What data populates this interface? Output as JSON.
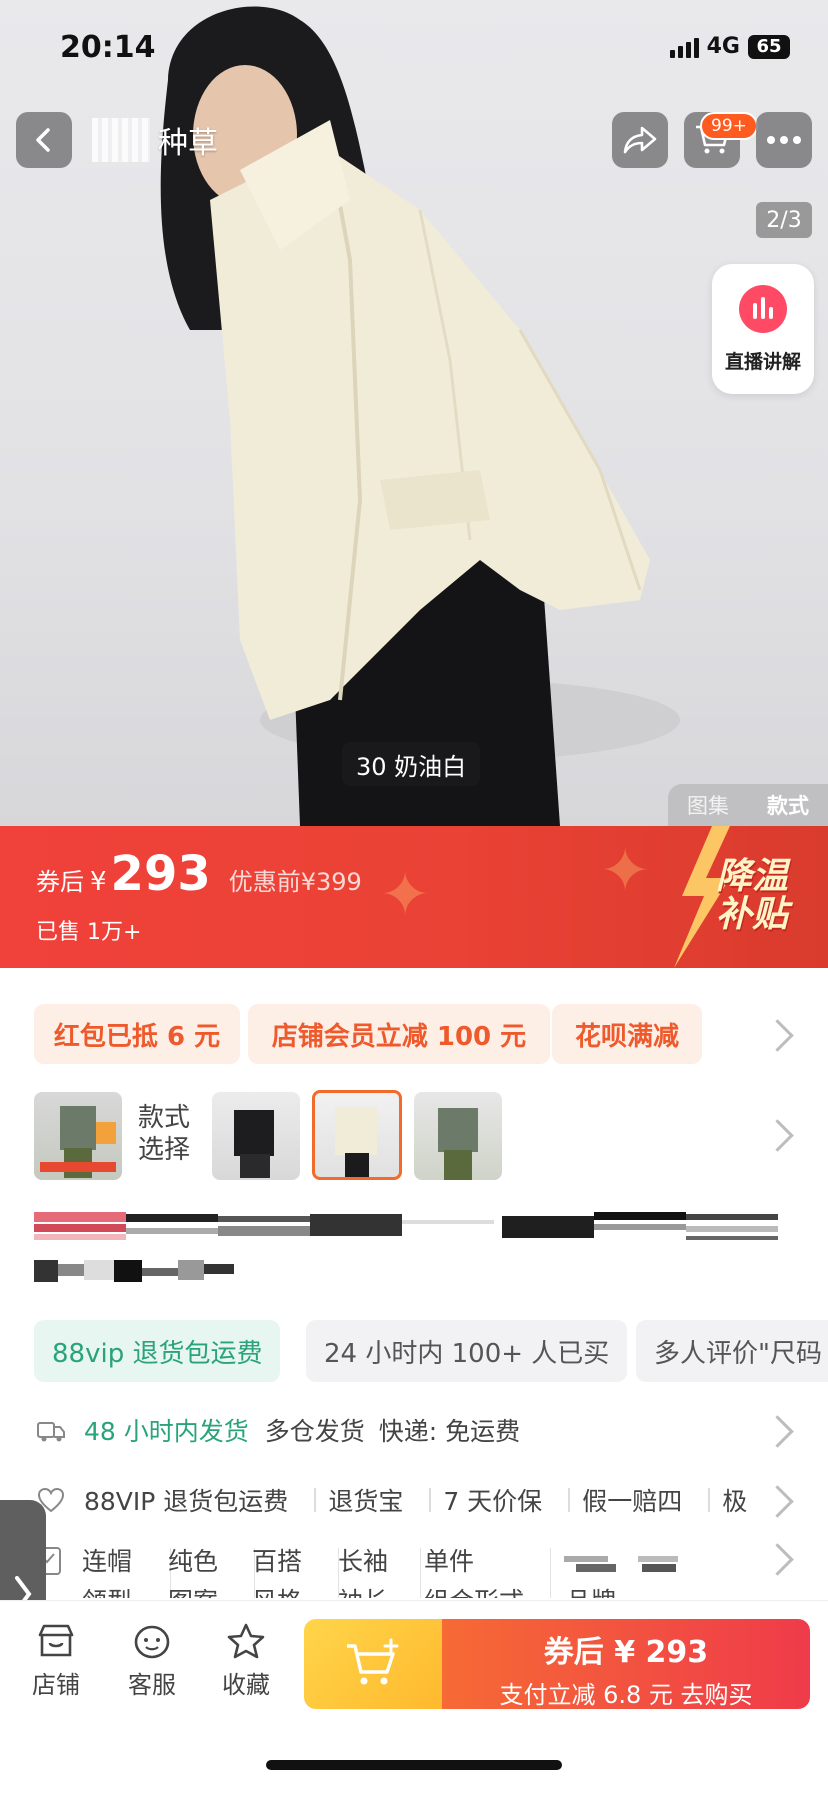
{
  "status_bar": {
    "time": "20:14",
    "network": "4G",
    "battery": "65"
  },
  "header": {
    "brand_text": "种草",
    "cart_badge": "99+",
    "gallery_counter": "2/3"
  },
  "live": {
    "label": "直播讲解"
  },
  "hero": {
    "color_label": "30 奶油白",
    "view_tabs": [
      "图集",
      "款式"
    ]
  },
  "price": {
    "prefix": "券后",
    "currency": "¥",
    "amount": "293",
    "original": "优惠前¥399",
    "sold": "已售 1万+",
    "promo_text": "降温\n补贴"
  },
  "coupons": [
    "红包已抵 6 元",
    "店铺会员立减 100 元",
    "花呗满减"
  ],
  "sku": {
    "label": "款式\n选择"
  },
  "tags": [
    "88vip 退货包运费",
    "24 小时内 100+ 人已买",
    "多人评价\"尺码"
  ],
  "shipping": {
    "highlight": "48 小时内发货",
    "multi": "多仓发货",
    "express": "快递: 免运费"
  },
  "services": [
    "88VIP 退货包运费",
    "退货宝",
    "7 天价保",
    "假一赔四",
    "极"
  ],
  "attributes": [
    [
      "连帽",
      "领型"
    ],
    [
      "纯色",
      "图案"
    ],
    [
      "百搭",
      "风格"
    ],
    [
      "长袖",
      "袖长"
    ],
    [
      "单件",
      "组合形式"
    ],
    [
      "",
      "品牌"
    ]
  ],
  "bottom_bar": {
    "store": "店铺",
    "service": "客服",
    "favorite": "收藏",
    "buy_line1": "券后 ¥ 293",
    "buy_line2": "支付立减 6.8 元  去购买"
  },
  "colors": {
    "accent_red": "#ea4235",
    "coupon_orange": "#ee5a2c",
    "vip_green": "#2aa37b",
    "cart_yellow": "#ffc23a"
  }
}
